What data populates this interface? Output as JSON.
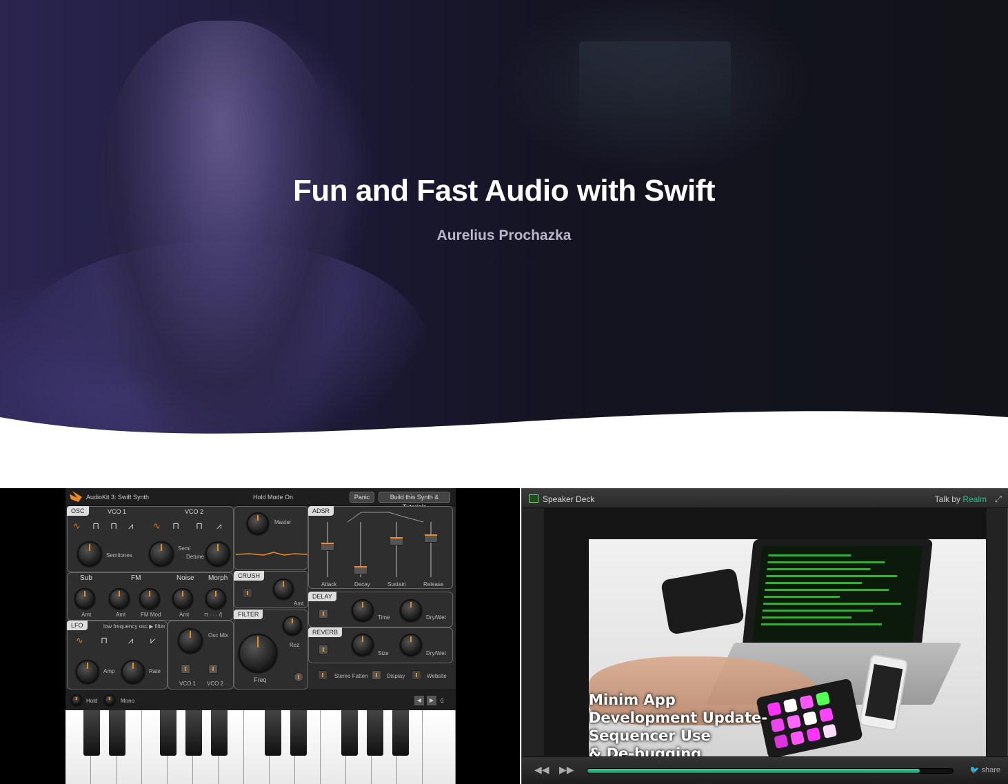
{
  "hero": {
    "title": "Fun and Fast Audio with Swift",
    "author": "Aurelius Prochazka"
  },
  "synth": {
    "app_title": "AudioKit 3: Swift Synth",
    "hold_mode": "Hold Mode On",
    "panic_button": "Panic",
    "build_button": "Build this Synth & Tutorials",
    "osc_tag": "OSC",
    "vco1": "VCO 1",
    "vco2": "VCO 2",
    "semitones": "Semitones",
    "semi": "Semi",
    "detune": "Detune",
    "master": "Master",
    "adsr": "ADSR",
    "attack": "Attack",
    "decay": "Decay",
    "sustain": "Sustain",
    "release": "Release",
    "sub": "Sub",
    "fm": "FM",
    "noise": "Noise",
    "morph": "Morph",
    "amt": "Amt",
    "fm_mod": "FM Mod",
    "crush": "CRUSH",
    "delay": "DELAY",
    "time": "Time",
    "dry_wet": "Dry/Wet",
    "lfo": "LFO",
    "lfo_desc": "low frequency osc ▶ filter",
    "osc_mix": "Osc Mix",
    "filter": "FILTER",
    "rez": "Rez",
    "freq": "Freq",
    "reverb": "REVERB",
    "size": "Size",
    "amp": "Amp",
    "rate": "Rate",
    "vco1_short": "VCO 1",
    "vco2_short": "VCO 2",
    "stereo_fatten": "Stereo Fatten",
    "display": "Display",
    "website": "Website",
    "hold": "Hold",
    "mono": "Mono",
    "octave": "0"
  },
  "deck": {
    "label": "Speaker Deck",
    "talk_by": "Talk by",
    "talk_by_name": "Realm",
    "slide_caption": [
      "Minim App",
      "Development Update-",
      "Sequencer Use",
      "& De-bugging"
    ],
    "share": "share",
    "progress": 0.91
  },
  "colors": {
    "accent": "#f08c1e",
    "deck_accent": "#2dbd8f"
  }
}
